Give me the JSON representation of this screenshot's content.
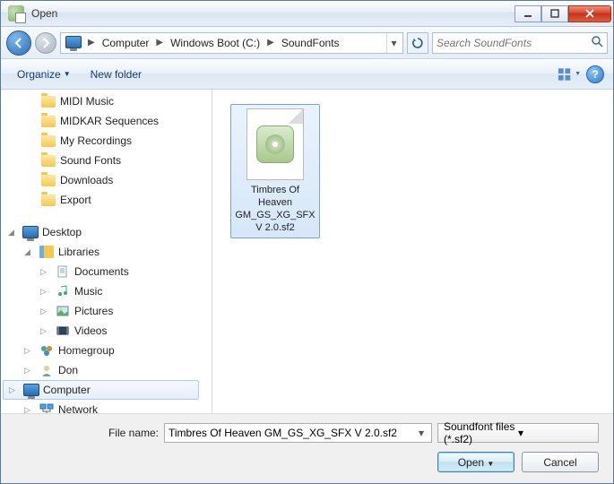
{
  "window": {
    "title": "Open"
  },
  "breadcrumb": {
    "root_icon": "computer",
    "items": [
      "Computer",
      "Windows Boot (C:)",
      "SoundFonts"
    ]
  },
  "search": {
    "placeholder": "Search SoundFonts"
  },
  "toolbar": {
    "organize": "Organize",
    "new_folder": "New folder"
  },
  "tree": {
    "top_folders": [
      "MIDI Music",
      "MIDKAR Sequences",
      "My Recordings",
      "Sound Fonts",
      "Downloads",
      "Export"
    ],
    "desktop": "Desktop",
    "libraries": "Libraries",
    "lib_items": [
      "Documents",
      "Music",
      "Pictures",
      "Videos"
    ],
    "homegroup": "Homegroup",
    "user": "Don",
    "computer": "Computer",
    "network": "Network"
  },
  "files": {
    "selected": {
      "name": "Timbres Of Heaven GM_GS_XG_SFX V 2.0.sf2"
    }
  },
  "footer": {
    "filename_label": "File name:",
    "filename_value": "Timbres Of Heaven GM_GS_XG_SFX V 2.0.sf2",
    "filter": "Soundfont files (*.sf2)",
    "open": "Open",
    "cancel": "Cancel"
  }
}
